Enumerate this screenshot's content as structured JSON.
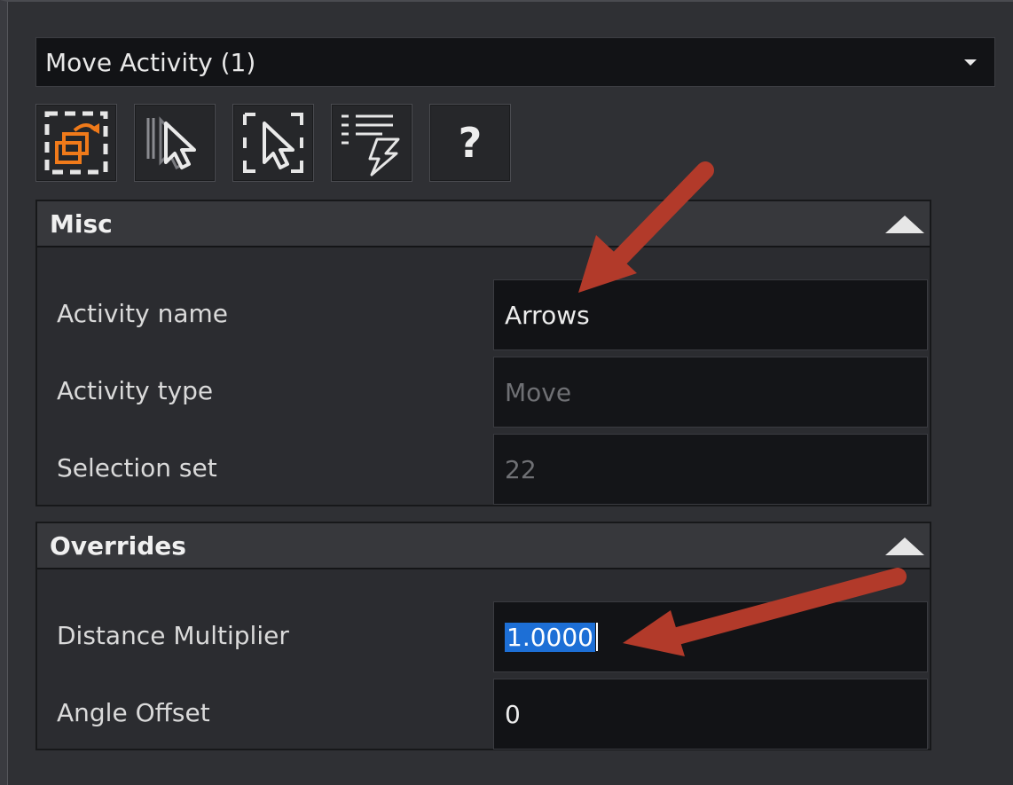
{
  "window": {
    "dropdown": {
      "selected": "Move Activity (1)"
    }
  },
  "toolbar": {
    "buttons": [
      {
        "name": "move-rotate-icon"
      },
      {
        "name": "multi-select-cursor-icon"
      },
      {
        "name": "box-select-cursor-icon"
      },
      {
        "name": "trigger-list-icon"
      },
      {
        "name": "help-icon",
        "glyph": "?"
      }
    ]
  },
  "misc": {
    "title": "Misc",
    "rows": [
      {
        "label": "Activity name",
        "value": "Arrows",
        "editable": true
      },
      {
        "label": "Activity type",
        "value": "Move",
        "editable": false
      },
      {
        "label": "Selection set",
        "value": "22",
        "editable": false
      }
    ]
  },
  "overrides": {
    "title": "Overrides",
    "rows": [
      {
        "label": "Distance Multiplier",
        "value": "1.0000",
        "editable": true,
        "selected": true
      },
      {
        "label": "Angle Offset",
        "value": "0",
        "editable": true
      }
    ]
  },
  "colors": {
    "accent_orange": "#f07a1a",
    "annotation_arrow": "#c0392b",
    "selection": "#1d6fd6"
  }
}
